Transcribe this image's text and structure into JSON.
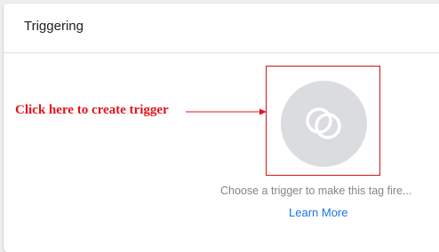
{
  "card": {
    "title": "Triggering"
  },
  "annotation": {
    "text": "Click here to create trigger",
    "color": "#e3141c"
  },
  "trigger": {
    "icon": "trigger-icon",
    "hint": "Choose a trigger to make this tag fire...",
    "learn_more": "Learn More"
  },
  "colors": {
    "accent": "#1a73e8",
    "highlight": "#d01515",
    "circle": "#dadce0"
  }
}
